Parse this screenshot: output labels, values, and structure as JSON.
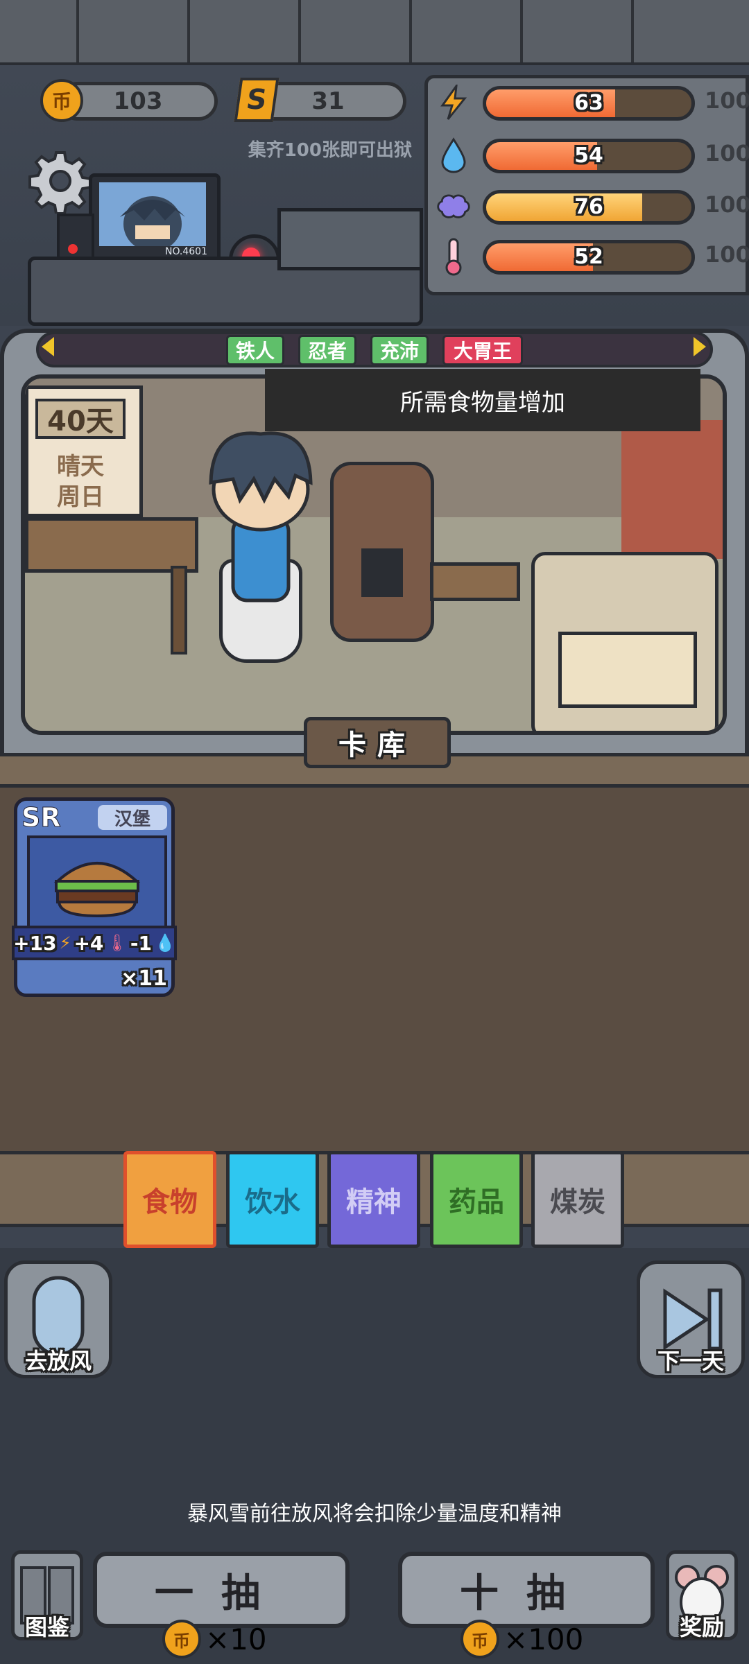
{
  "currency": {
    "coins": "103",
    "shards": "31",
    "shards_note": "集齐100张即可出狱",
    "coin_symbol": "币",
    "shard_symbol": "S"
  },
  "stats": [
    {
      "icon": "energy-icon",
      "value": "63",
      "level": 0.63,
      "max": "100",
      "color": "#f5a623"
    },
    {
      "icon": "water-icon",
      "value": "54",
      "level": 0.54,
      "max": "100",
      "color": "#5bb8f0"
    },
    {
      "icon": "brain-icon",
      "value": "76",
      "level": 0.76,
      "max": "100",
      "color": "#7a6ee8"
    },
    {
      "icon": "thermometer-icon",
      "value": "52",
      "level": 0.52,
      "max": "100",
      "color": "#f06a8c"
    }
  ],
  "prisoner_id": "NO.4601",
  "traits": [
    "铁人",
    "忍者",
    "充沛",
    "大胃王"
  ],
  "trait_tooltip": "所需食物量增加",
  "calendar": {
    "day": "40天",
    "weather": "晴天",
    "weekday": "周日"
  },
  "library_title": "卡库",
  "card": {
    "rarity": "SR",
    "name": "汉堡",
    "effects": "+13⚡+4🌡-1💧",
    "effect_parts": [
      "+13",
      "+4",
      "-1"
    ],
    "count": "×11"
  },
  "categories": [
    {
      "label": "食物",
      "color": "#f0a040",
      "active": true
    },
    {
      "label": "饮水",
      "color": "#2fc7f0",
      "active": false
    },
    {
      "label": "精神",
      "color": "#7468d8",
      "active": false
    },
    {
      "label": "药品",
      "color": "#6cc45a",
      "active": false
    },
    {
      "label": "煤炭",
      "color": "#a8a8ae",
      "active": false
    }
  ],
  "buttons": {
    "outing": "去放风",
    "next_day": "下一天",
    "codex": "图鉴",
    "rewards": "奖励",
    "draw_one": "一抽",
    "draw_ten": "十抽",
    "draw_one_cost": "×10",
    "draw_ten_cost": "×100"
  },
  "hint": "暴风雪前往放风将会扣除少量温度和精神"
}
